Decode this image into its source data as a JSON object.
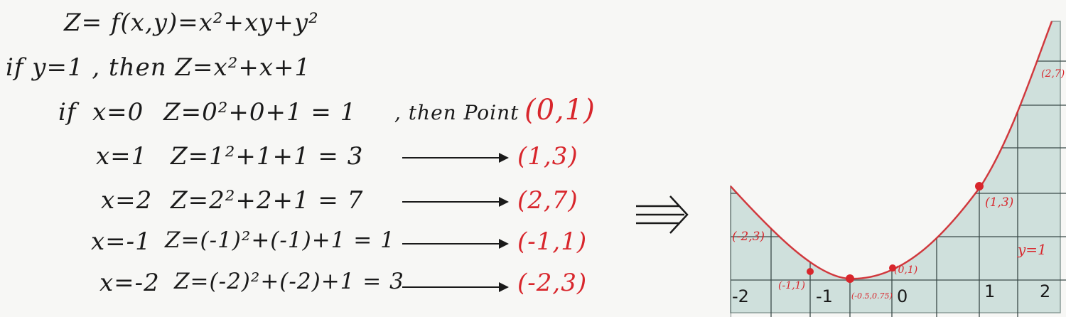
{
  "notes": {
    "function_line": "Z= f(x,y)=x²+xy+y²",
    "if_line": "if y=1 , then Z=x²+x+1",
    "rows": [
      {
        "prefix": "if",
        "x_expr": "x=0",
        "z_expr": "Z=0²+0+1 = 1",
        "connector": ", then Point",
        "point": "(0,1)"
      },
      {
        "prefix": "",
        "x_expr": "x=1",
        "z_expr": "Z=1²+1+1 = 3",
        "connector": "",
        "point": "(1,3)"
      },
      {
        "prefix": "",
        "x_expr": "x=2",
        "z_expr": "Z=2²+2+1 = 7",
        "connector": "",
        "point": "(2,7)"
      },
      {
        "prefix": "",
        "x_expr": "x=-1",
        "z_expr": "Z=(-1)²+(-1)+1 = 1",
        "connector": "",
        "point": "(-1,1)"
      },
      {
        "prefix": "",
        "x_expr": "x=-2",
        "z_expr": "Z=(-2)²+(-2)+1 = 3",
        "connector": "",
        "point": "(-2,3)"
      }
    ]
  },
  "graph": {
    "curve_label": "y=1",
    "x_ticks": [
      "-2",
      "-1",
      "0",
      "1",
      "2"
    ],
    "point_labels": [
      "(2,7)",
      "(1,3)",
      "(-2,3)",
      "(-1,1)",
      "(0,1)",
      "(-0.5,0.75)"
    ],
    "curve_color": "#d8262c",
    "fill_color": "#cfe0dc"
  }
}
